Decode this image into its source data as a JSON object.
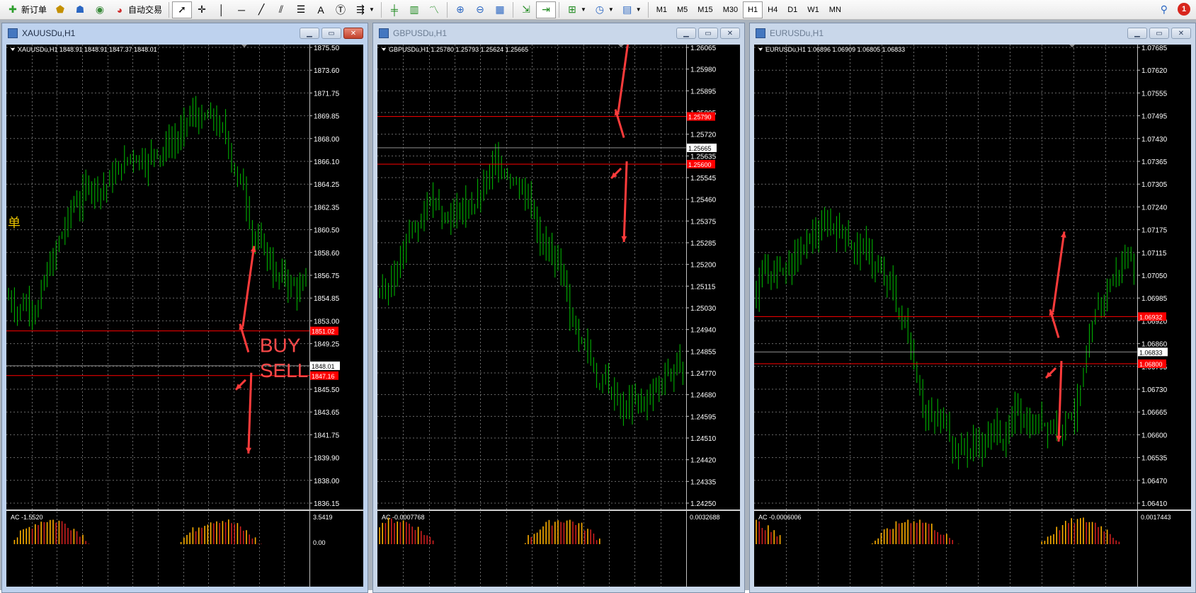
{
  "toolbar": {
    "new_order": "新订单",
    "auto_trade": "自动交易",
    "timeframes": [
      "M1",
      "M5",
      "M15",
      "M30",
      "H1",
      "H4",
      "D1",
      "W1",
      "MN"
    ],
    "active_timeframe": "H1",
    "notifications": "1"
  },
  "windows": [
    {
      "title": "XAUUSDu,H1",
      "info": "XAUUSDu,H1  1848.91 1848.91 1847.37 1848.01",
      "indicator": "AC -1.5520",
      "ind_axis": [
        "3.5419",
        "0.00"
      ],
      "ylabels": [
        "1875.50",
        "1873.60",
        "1871.75",
        "1869.85",
        "1868.00",
        "1866.10",
        "1864.25",
        "1862.35",
        "1860.50",
        "1858.60",
        "1856.75",
        "1854.85",
        "1853.00",
        "1849.25",
        "1847.40",
        "1845.50",
        "1843.65",
        "1841.75",
        "1839.90",
        "1838.00",
        "1836.15"
      ],
      "ymin": 1836.15,
      "ymax": 1875.5,
      "current": "1848.01",
      "current_value": 1848.01,
      "levels": [
        {
          "label": "1851.02",
          "value": 1851.02
        },
        {
          "label": "1847.16",
          "value": 1847.16
        }
      ],
      "side_char": "单",
      "texts": [
        "BUY",
        "SELL"
      ]
    },
    {
      "title": "GBPUSDu,H1",
      "info": "GBPUSDu,H1  1.25780 1.25793 1.25624 1.25665",
      "indicator": "AC -0.0007768",
      "ind_axis": [
        "0.0032688"
      ],
      "ylabels": [
        "1.26065",
        "1.25980",
        "1.25895",
        "1.25805",
        "1.25720",
        "1.25635",
        "1.25545",
        "1.25460",
        "1.25375",
        "1.25285",
        "1.25200",
        "1.25115",
        "1.25030",
        "1.24940",
        "1.24855",
        "1.24770",
        "1.24680",
        "1.24595",
        "1.24510",
        "1.24420",
        "1.24335",
        "1.24250"
      ],
      "ymin": 1.2425,
      "ymax": 1.26065,
      "current": "1.25665",
      "current_value": 1.25665,
      "levels": [
        {
          "label": "1.25790",
          "value": 1.2579
        },
        {
          "label": "1.25600",
          "value": 1.256
        }
      ],
      "side_char": "",
      "texts": []
    },
    {
      "title": "EURUSDu,H1",
      "info": "EURUSDu,H1  1.06896 1.06909 1.06805 1.06833",
      "indicator": "AC -0.0006006",
      "ind_axis": [
        "0.0017443"
      ],
      "ylabels": [
        "1.07685",
        "1.07620",
        "1.07555",
        "1.07495",
        "1.07430",
        "1.07365",
        "1.07305",
        "1.07240",
        "1.07175",
        "1.07115",
        "1.07050",
        "1.06985",
        "1.06920",
        "1.06860",
        "1.06795",
        "1.06730",
        "1.06665",
        "1.06600",
        "1.06535",
        "1.06470",
        "1.06410"
      ],
      "ymin": 1.0641,
      "ymax": 1.07685,
      "current": "1.06833",
      "current_value": 1.06833,
      "levels": [
        {
          "label": "1.06932",
          "value": 1.06932
        },
        {
          "label": "1.06800",
          "value": 1.068
        }
      ],
      "side_char": "",
      "texts": []
    }
  ],
  "colors": {
    "candle": "#00c000",
    "grid": "#6a6a6a",
    "level": "#ff0000",
    "arrow": "#ff3b3b",
    "ac_up": "#ffb000",
    "ac_down": "#cc1f1f"
  }
}
